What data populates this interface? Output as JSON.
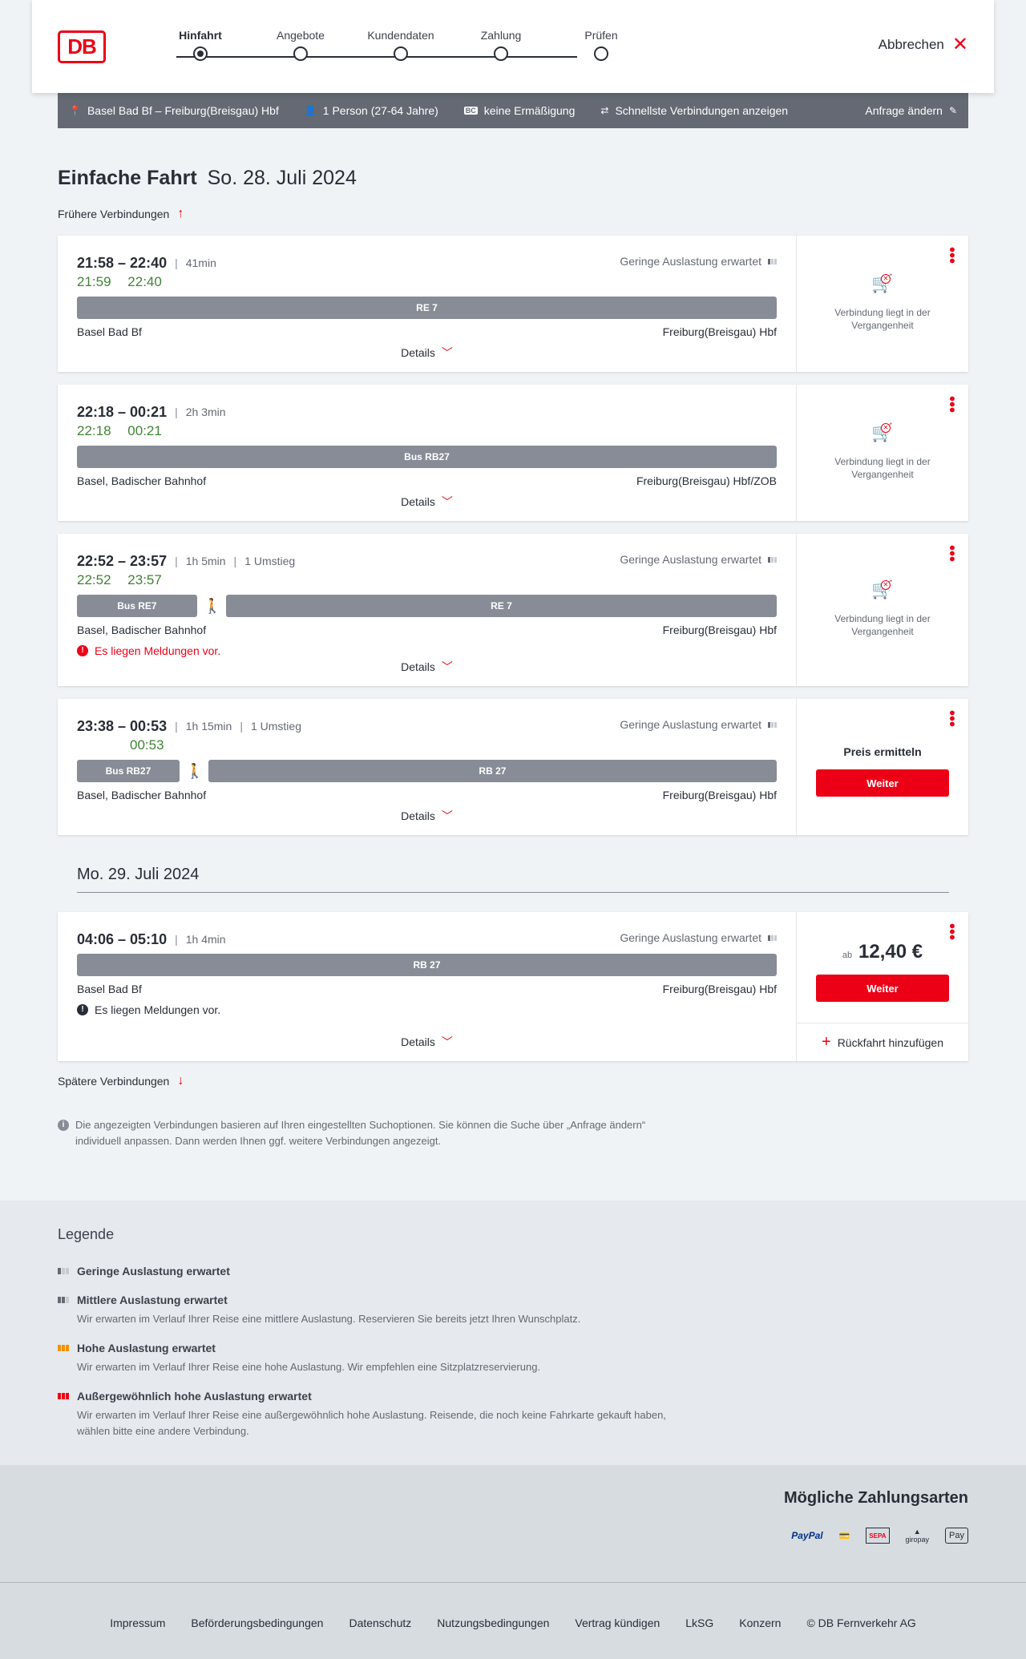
{
  "header": {
    "logo": "DB",
    "steps": [
      "Hinfahrt",
      "Angebote",
      "Kundendaten",
      "Zahlung",
      "Prüfen"
    ],
    "active_step": 0,
    "cancel": "Abbrechen"
  },
  "search": {
    "route": "Basel Bad Bf – Freiburg(Breisgau) Hbf",
    "persons": "1 Person (27-64 Jahre)",
    "discount_badge": "BC",
    "discount": "keine Ermäßigung",
    "fastest": "Schnellste Verbindungen anzeigen",
    "change": "Anfrage ändern"
  },
  "title": {
    "bold": "Einfache Fahrt",
    "date": "So. 28. Juli 2024"
  },
  "earlier": "Frühere Verbindungen",
  "later": "Spätere Verbindungen",
  "details_label": "Details",
  "occupancy_low": "Geringe Auslastung erwartet",
  "past_text": "Verbindung liegt in der Vergangenheit",
  "price_label": "Preis ermitteln",
  "weiter": "Weiter",
  "price_prefix": "ab",
  "return_label": "Rückfahrt hinzufügen",
  "connections": [
    {
      "times": "21:58 – 22:40",
      "duration": "41min",
      "transfers": "",
      "rt_dep": "21:59",
      "rt_arr": "22:40",
      "bars": [
        "RE 7"
      ],
      "from": "Basel Bad Bf",
      "to": "Freiburg(Breisgau) Hbf",
      "message": ""
    },
    {
      "times": "22:18 – 00:21",
      "duration": "2h 3min",
      "transfers": "",
      "rt_dep": "22:18",
      "rt_arr": "00:21",
      "bars": [
        "Bus RB27"
      ],
      "from": "Basel, Badischer Bahnhof",
      "to": "Freiburg(Breisgau) Hbf/ZOB",
      "message": ""
    },
    {
      "times": "22:52 – 23:57",
      "duration": "1h 5min",
      "transfers": "1 Umstieg",
      "rt_dep": "22:52",
      "rt_arr": "23:57",
      "bars": [
        "Bus RE7",
        "RE 7"
      ],
      "from": "Basel, Badischer Bahnhof",
      "to": "Freiburg(Breisgau) Hbf",
      "message": "Es liegen Meldungen vor."
    },
    {
      "times": "23:38 – 00:53",
      "duration": "1h 15min",
      "transfers": "1 Umstieg",
      "rt_dep": "",
      "rt_arr": "00:53",
      "bars": [
        "Bus RB27",
        "RB 27"
      ],
      "from": "Basel, Badischer Bahnhof",
      "to": "Freiburg(Breisgau) Hbf",
      "message": ""
    },
    {
      "times": "04:06 – 05:10",
      "duration": "1h 4min",
      "transfers": "",
      "bars": [
        "RB 27"
      ],
      "from": "Basel Bad Bf",
      "to": "Freiburg(Breisgau) Hbf",
      "message": "Es liegen Meldungen vor.",
      "price": "12,40 €"
    }
  ],
  "date2": "Mo. 29. Juli 2024",
  "info": "Die angezeigten Verbindungen basieren auf Ihren eingestellten Suchoptionen. Sie können die Suche über „Anfrage ändern“ individuell anpassen. Dann werden Ihnen ggf. weitere Verbindungen angezeigt.",
  "legend": {
    "title": "Legende",
    "items": [
      {
        "title": "Geringe Auslastung erwartet",
        "desc": ""
      },
      {
        "title": "Mittlere Auslastung erwartet",
        "desc": "Wir erwarten im Verlauf Ihrer Reise eine mittlere Auslastung. Reservieren Sie bereits jetzt Ihren Wunschplatz."
      },
      {
        "title": "Hohe Auslastung erwartet",
        "desc": "Wir erwarten im Verlauf Ihrer Reise eine hohe Auslastung. Wir empfehlen eine Sitzplatzreservierung."
      },
      {
        "title": "Außergewöhnlich hohe Auslastung erwartet",
        "desc": "Wir erwarten im Verlauf Ihrer Reise eine außergewöhnlich hohe Auslastung. Reisende, die noch keine Fahrkarte gekauft haben, wählen bitte eine andere Verbindung."
      }
    ]
  },
  "payment": {
    "title": "Mögliche Zahlungsarten",
    "methods": [
      "PayPal",
      "SEPA",
      "giropay",
      "Pay"
    ]
  },
  "footer": {
    "links": [
      "Impressum",
      "Beförderungsbedingungen",
      "Datenschutz",
      "Nutzungsbedingungen",
      "Vertrag kündigen",
      "LkSG",
      "Konzern",
      "© DB Fernverkehr AG"
    ]
  },
  "colors": {
    "accent": "#ec0016",
    "realtime": "#408335",
    "bar": "#878c96",
    "searchbar": "#646973"
  }
}
